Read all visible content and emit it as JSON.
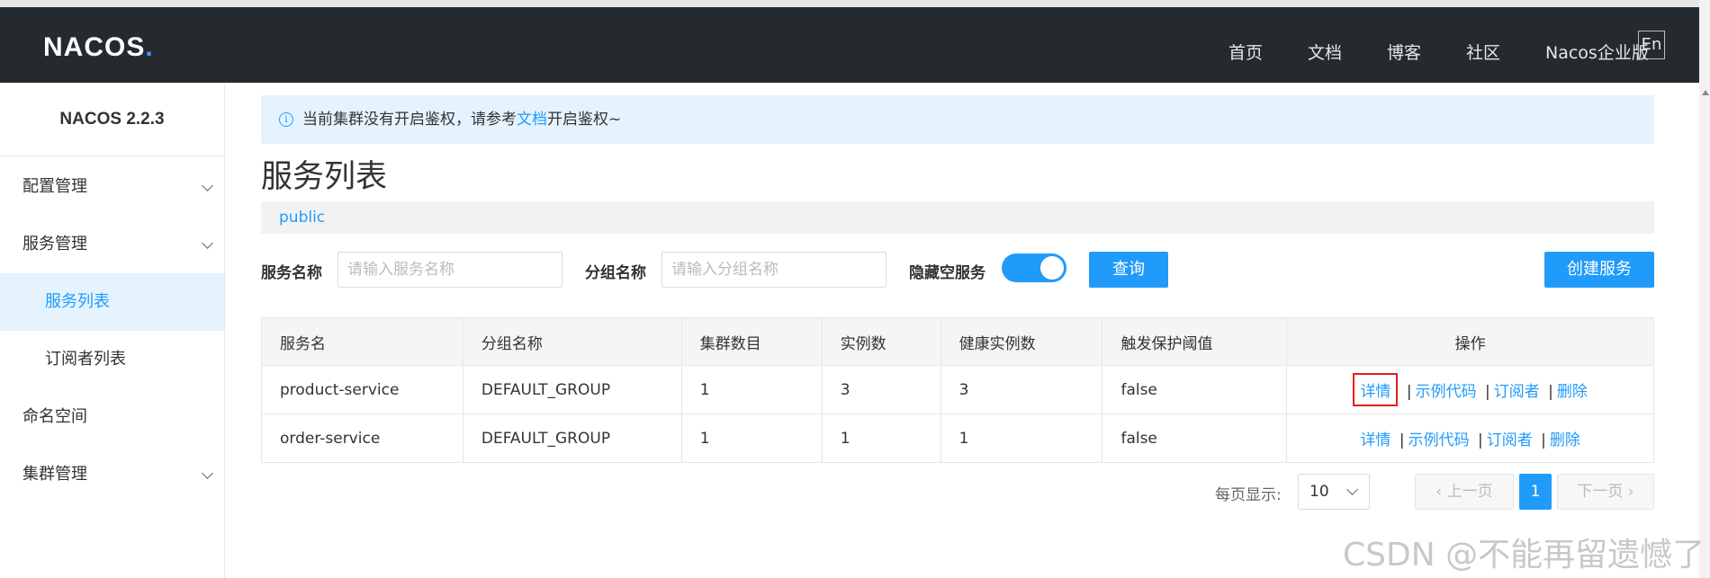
{
  "header": {
    "logo_text": "NACOS",
    "logo_dot": ".",
    "nav": [
      "首页",
      "文档",
      "博客",
      "社区",
      "Nacos企业版"
    ],
    "lang_button": "En"
  },
  "sidebar": {
    "version": "NACOS 2.2.3",
    "items": [
      {
        "label": "配置管理",
        "expandable": true
      },
      {
        "label": "服务管理",
        "expandable": true
      },
      {
        "label": "服务列表",
        "active": true
      },
      {
        "label": "订阅者列表"
      },
      {
        "label": "命名空间"
      },
      {
        "label": "集群管理",
        "expandable": true
      }
    ]
  },
  "notice": {
    "icon": "info-icon",
    "prefix": "当前集群没有开启鉴权，请参考",
    "link": "文档",
    "suffix": "开启鉴权~"
  },
  "page": {
    "title": "服务列表",
    "namespace": "public"
  },
  "filters": {
    "service_name_label": "服务名称",
    "service_name_placeholder": "请输入服务名称",
    "group_name_label": "分组名称",
    "group_name_placeholder": "请输入分组名称",
    "hide_empty_label": "隐藏空服务",
    "hide_empty_on": true,
    "query_button": "查询",
    "create_button": "创建服务"
  },
  "table": {
    "headers": [
      "服务名",
      "分组名称",
      "集群数目",
      "实例数",
      "健康实例数",
      "触发保护阈值",
      "操作"
    ],
    "rows": [
      [
        "product-service",
        "DEFAULT_GROUP",
        "1",
        "3",
        "3",
        "false"
      ],
      [
        "order-service",
        "DEFAULT_GROUP",
        "1",
        "1",
        "1",
        "false"
      ]
    ],
    "actions": [
      "详情",
      "示例代码",
      "订阅者",
      "删除"
    ],
    "action_separator": "|"
  },
  "pagination": {
    "page_size_label": "每页显示:",
    "page_size": "10",
    "prev": "上一页",
    "current": "1",
    "next": "下一页"
  },
  "watermark": "CSDN @不能再留遗憾了",
  "colors": {
    "primary": "#209bfa",
    "topbar": "#252a2f",
    "highlight_border": "#e02020"
  }
}
